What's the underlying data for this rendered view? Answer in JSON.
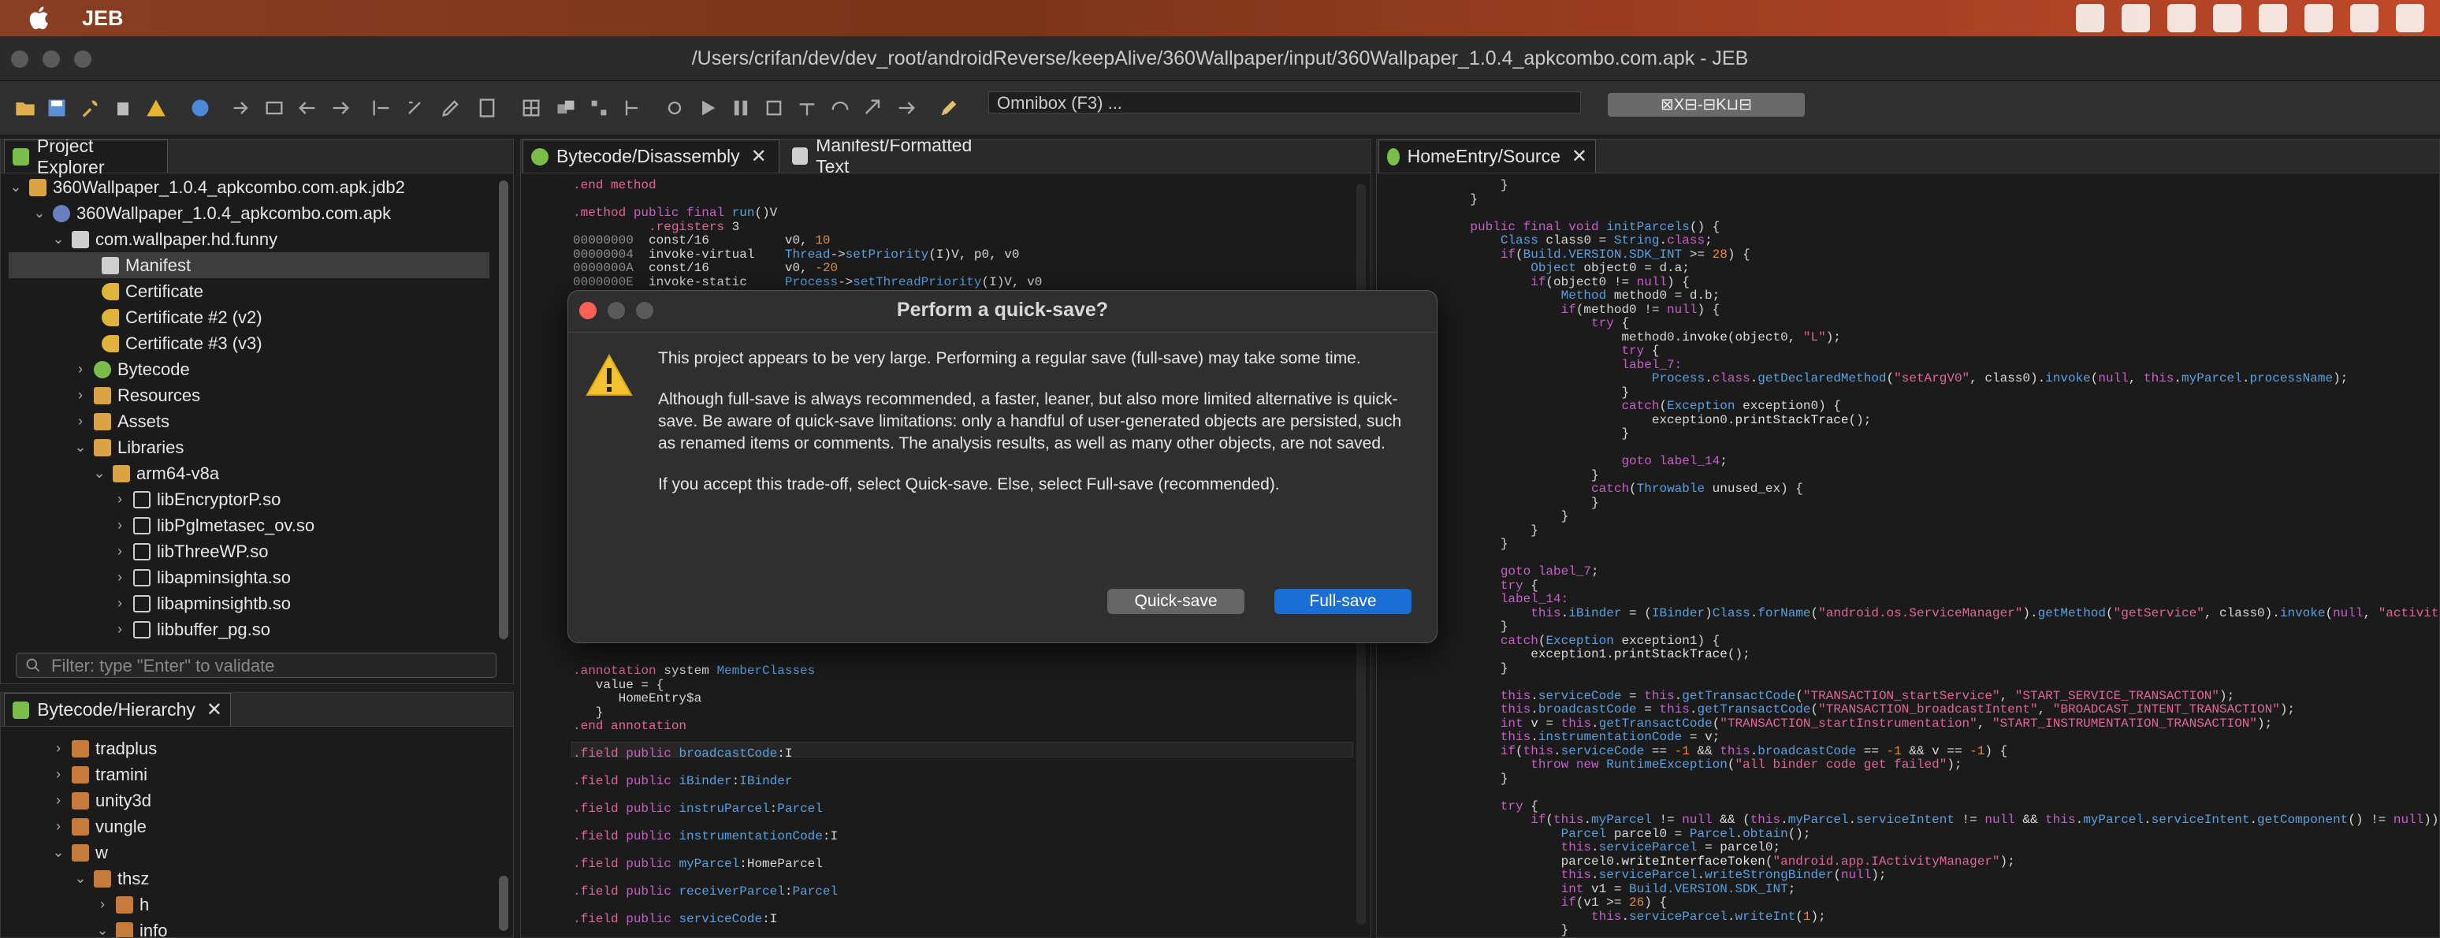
{
  "menubar": {
    "app_name": "JEB"
  },
  "window": {
    "title": "/Users/crifan/dev/dev_root/androidReverse/keepAlive/360Wallpaper/input/360Wallpaper_1.0.4_apkcombo.com.apk - JEB"
  },
  "toolbar": {
    "omnibox_placeholder": "Omnibox (F3) ...",
    "omnibox_button": "⊠X⊟-⊟K⊔⊟"
  },
  "project_explorer": {
    "tab_label": "Project Explorer",
    "items": [
      {
        "label": "360Wallpaper_1.0.4_apkcombo.com.apk.jdb2"
      },
      {
        "label": "360Wallpaper_1.0.4_apkcombo.com.apk"
      },
      {
        "label": "com.wallpaper.hd.funny"
      },
      {
        "label": "Manifest"
      },
      {
        "label": "Certificate"
      },
      {
        "label": "Certificate #2 (v2)"
      },
      {
        "label": "Certificate #3 (v3)"
      },
      {
        "label": "Bytecode"
      },
      {
        "label": "Resources"
      },
      {
        "label": "Assets"
      },
      {
        "label": "Libraries"
      },
      {
        "label": "arm64-v8a"
      },
      {
        "label": "libEncryptorP.so"
      },
      {
        "label": "libPglmetasec_ov.so"
      },
      {
        "label": "libThreeWP.so"
      },
      {
        "label": "libapminsighta.so"
      },
      {
        "label": "libapminsightb.so"
      },
      {
        "label": "libbuffer_pg.so"
      }
    ],
    "filter_placeholder": "Filter: type \"Enter\" to validate"
  },
  "hierarchy": {
    "tab_label": "Bytecode/Hierarchy",
    "items": [
      {
        "label": "tradplus"
      },
      {
        "label": "tramini"
      },
      {
        "label": "unity3d"
      },
      {
        "label": "vungle"
      },
      {
        "label": "w"
      },
      {
        "label": "thsz"
      },
      {
        "label": "h"
      },
      {
        "label": "info"
      }
    ]
  },
  "center_tabs": {
    "tab1": "Bytecode/Disassembly",
    "tab2": "Manifest/Formatted Text"
  },
  "right_tab": {
    "label": "HomeEntry/Source"
  },
  "dialog": {
    "title": "Perform a quick-save?",
    "para1": "This project appears to be very large. Performing a regular save (full-save) may take some time.",
    "para2": "Although full-save is always recommended, a faster, leaner, but also more limited alternative is quick-save. Be aware of quick-save limitations: only a handful of user-generated objects are persisted, such as renamed items or comments. The analysis results, as well as many other objects, are not saved.",
    "para3": "If you accept this trade-off, select Quick-save. Else, select Full-save (recommended).",
    "quick_label": "Quick-save",
    "full_label": "Full-save"
  }
}
